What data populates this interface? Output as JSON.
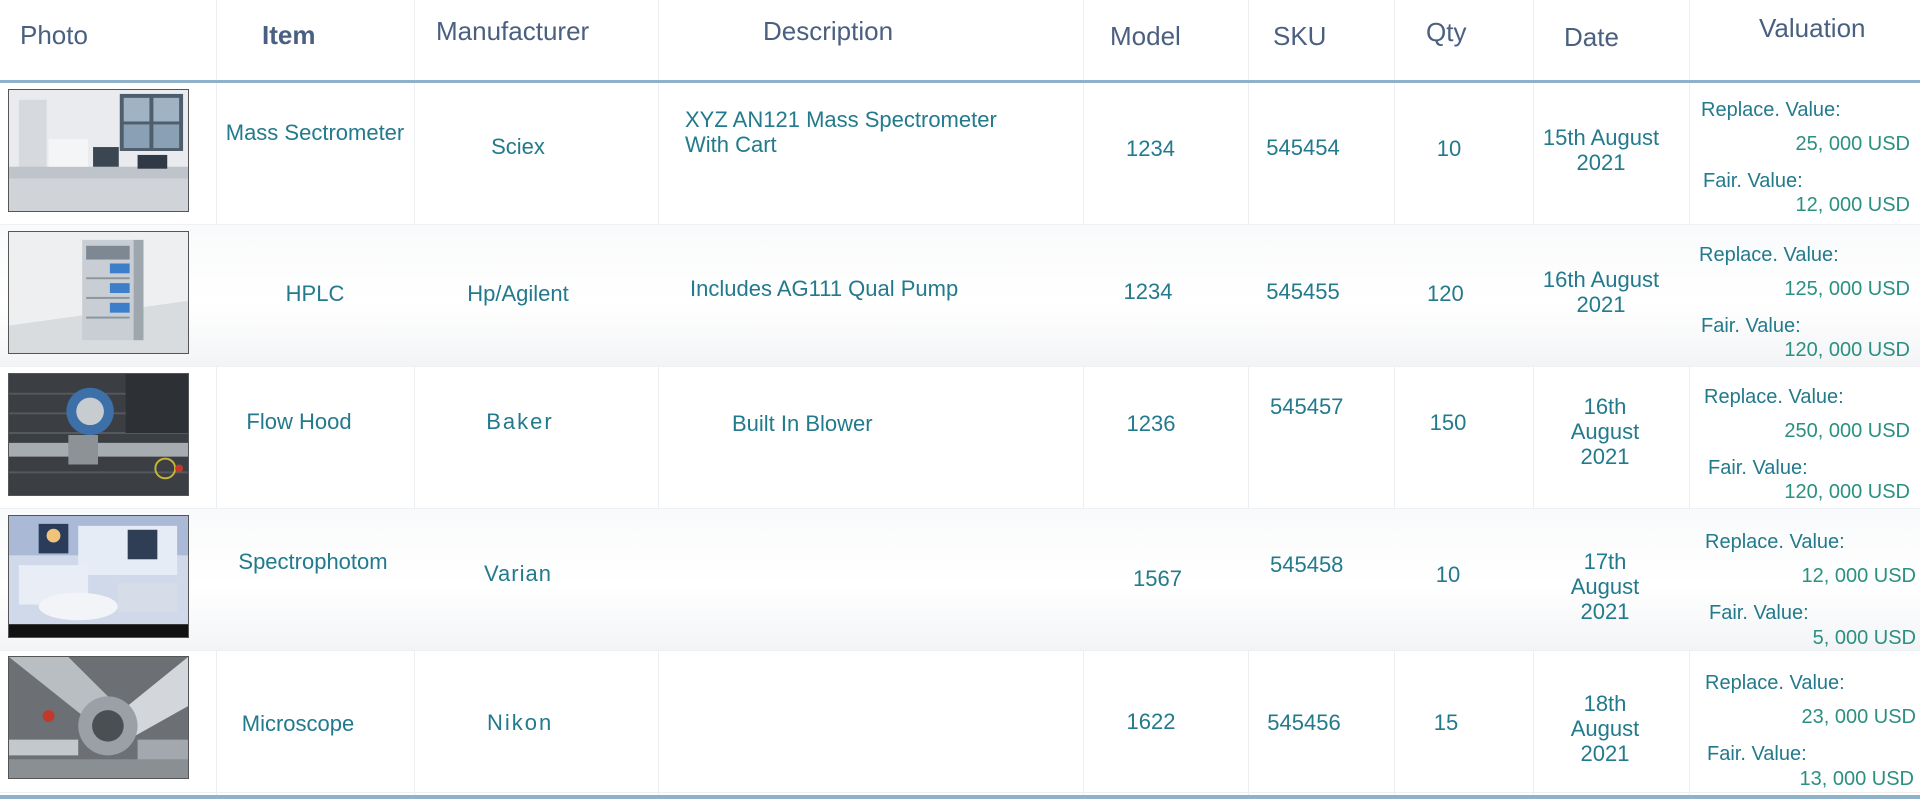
{
  "headers": {
    "photo": "Photo",
    "item": "Item",
    "manufacturer": "Manufacturer",
    "description": "Description",
    "model": "Model",
    "sku": "SKU",
    "qty": "Qty",
    "date": "Date",
    "valuation": "Valuation"
  },
  "valuation_labels": {
    "replace": "Replace. Value:",
    "fair": "Fair. Value:"
  },
  "rows": [
    {
      "photo_icon": "lab-room-photo",
      "item": "Mass Sectrometer",
      "manufacturer": "Sciex",
      "description": "XYZ AN121 Mass Spectrometer With Cart",
      "model": "1234",
      "sku": "545454",
      "qty": "10",
      "date": "15th August 2021",
      "replace_value": "25, 000  USD",
      "fair_value": "12, 000  USD"
    },
    {
      "photo_icon": "hplc-machine-photo",
      "item": "HPLC",
      "manufacturer": "Hp/Agilent",
      "description": "Includes AG111 Qual Pump",
      "model": "1234",
      "sku": "545455",
      "qty": "120",
      "date": "16th August 2021",
      "replace_value": "125, 000  USD",
      "fair_value": "120, 000  USD"
    },
    {
      "photo_icon": "flow-hood-photo",
      "item": "Flow Hood",
      "manufacturer": "Baker",
      "description": "Built In Blower",
      "model": "1236",
      "sku": "545457",
      "qty": "150",
      "date": "16th August 2021",
      "replace_value": "250, 000  USD",
      "fair_value": "120, 000  USD"
    },
    {
      "photo_icon": "spectrophotometer-photo",
      "item": "Spectrophotom",
      "manufacturer": "Varian",
      "description": "",
      "model": "1567",
      "sku": "545458",
      "qty": "10",
      "date": "17th August 2021",
      "replace_value": "12, 000  USD",
      "fair_value": "5, 000  USD"
    },
    {
      "photo_icon": "microscope-photo",
      "item": "Microscope",
      "manufacturer": "Nikon",
      "description": "",
      "model": "1622",
      "sku": "545456",
      "qty": "15",
      "date": "18th August 2021",
      "replace_value": "23, 000  USD",
      "fair_value": "13, 000  USD"
    }
  ]
}
